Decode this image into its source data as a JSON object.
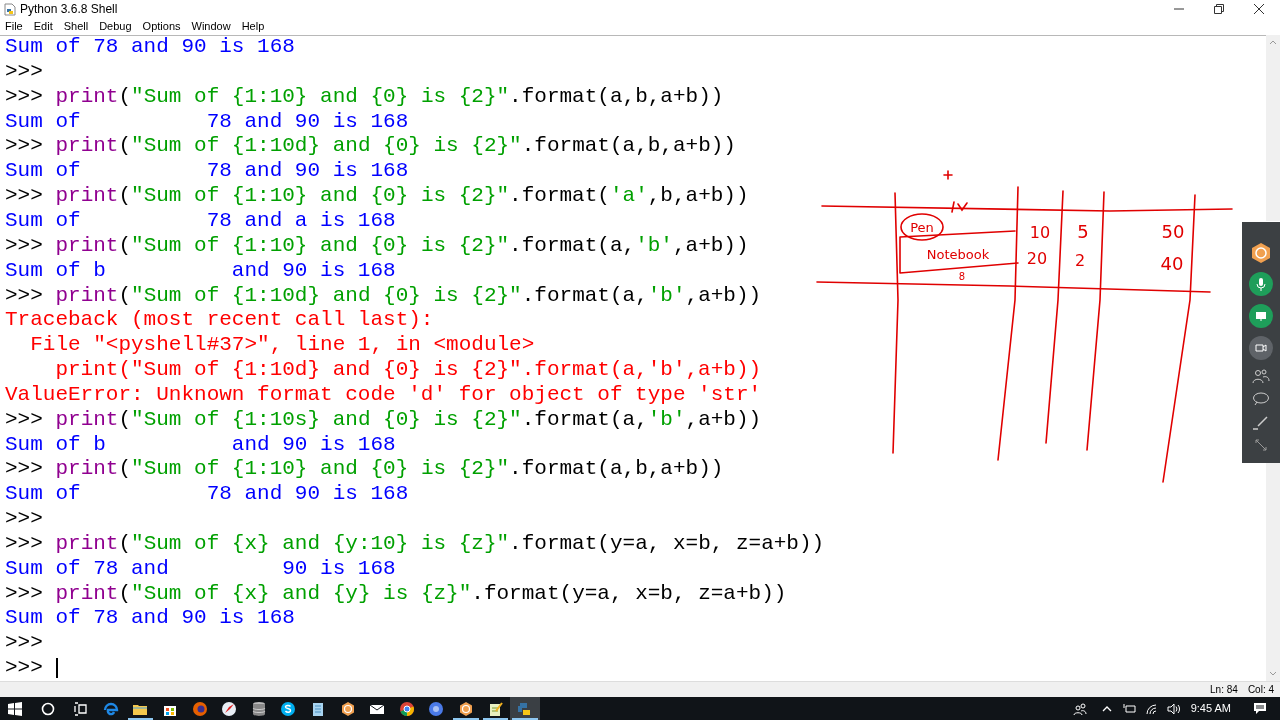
{
  "window": {
    "title": "Python 3.6.8 Shell"
  },
  "menu": [
    "File",
    "Edit",
    "Shell",
    "Debug",
    "Options",
    "Window",
    "Help"
  ],
  "shell_lines": [
    {
      "kind": "output",
      "text": "Sum of 78 and 90 is 168"
    },
    {
      "kind": "input",
      "prompt": ">>>"
    },
    {
      "kind": "input",
      "prompt": ">>>",
      "segments": [
        {
          "kind": "builtin",
          "text": "print"
        },
        {
          "kind": "plain",
          "text": "("
        },
        {
          "kind": "string",
          "text": "\"Sum of {1:10} and {0} is {2}\""
        },
        {
          "kind": "plain",
          "text": ".format(a,b,a+b))"
        }
      ]
    },
    {
      "kind": "output",
      "text": "Sum of          78 and 90 is 168"
    },
    {
      "kind": "input",
      "prompt": ">>>",
      "segments": [
        {
          "kind": "builtin",
          "text": "print"
        },
        {
          "kind": "plain",
          "text": "("
        },
        {
          "kind": "string",
          "text": "\"Sum of {1:10d} and {0} is {2}\""
        },
        {
          "kind": "plain",
          "text": ".format(a,b,a+b))"
        }
      ]
    },
    {
      "kind": "output",
      "text": "Sum of          78 and 90 is 168"
    },
    {
      "kind": "input",
      "prompt": ">>>",
      "segments": [
        {
          "kind": "builtin",
          "text": "print"
        },
        {
          "kind": "plain",
          "text": "("
        },
        {
          "kind": "string",
          "text": "\"Sum of {1:10} and {0} is {2}\""
        },
        {
          "kind": "plain",
          "text": ".format("
        },
        {
          "kind": "string",
          "text": "'a'"
        },
        {
          "kind": "plain",
          "text": ",b,a+b))"
        }
      ]
    },
    {
      "kind": "output",
      "text": "Sum of          78 and a is 168"
    },
    {
      "kind": "input",
      "prompt": ">>>",
      "segments": [
        {
          "kind": "builtin",
          "text": "print"
        },
        {
          "kind": "plain",
          "text": "("
        },
        {
          "kind": "string",
          "text": "\"Sum of {1:10} and {0} is {2}\""
        },
        {
          "kind": "plain",
          "text": ".format(a,"
        },
        {
          "kind": "string",
          "text": "'b'"
        },
        {
          "kind": "plain",
          "text": ",a+b))"
        }
      ]
    },
    {
      "kind": "output",
      "text": "Sum of b          and 90 is 168"
    },
    {
      "kind": "input",
      "prompt": ">>>",
      "segments": [
        {
          "kind": "builtin",
          "text": "print"
        },
        {
          "kind": "plain",
          "text": "("
        },
        {
          "kind": "string",
          "text": "\"Sum of {1:10d} and {0} is {2}\""
        },
        {
          "kind": "plain",
          "text": ".format(a,"
        },
        {
          "kind": "string",
          "text": "'b'"
        },
        {
          "kind": "plain",
          "text": ",a+b))"
        }
      ]
    },
    {
      "kind": "error",
      "text": "Traceback (most recent call last):"
    },
    {
      "kind": "error",
      "text": "  File \"<pyshell#37>\", line 1, in <module>"
    },
    {
      "kind": "error",
      "text": "    print(\"Sum of {1:10d} and {0} is {2}\".format(a,'b',a+b))"
    },
    {
      "kind": "error",
      "text": "ValueError: Unknown format code 'd' for object of type 'str'"
    },
    {
      "kind": "input",
      "prompt": ">>>",
      "segments": [
        {
          "kind": "builtin",
          "text": "print"
        },
        {
          "kind": "plain",
          "text": "("
        },
        {
          "kind": "string",
          "text": "\"Sum of {1:10s} and {0} is {2}\""
        },
        {
          "kind": "plain",
          "text": ".format(a,"
        },
        {
          "kind": "string",
          "text": "'b'"
        },
        {
          "kind": "plain",
          "text": ",a+b))"
        }
      ]
    },
    {
      "kind": "output",
      "text": "Sum of b          and 90 is 168"
    },
    {
      "kind": "input",
      "prompt": ">>>",
      "segments": [
        {
          "kind": "builtin",
          "text": "print"
        },
        {
          "kind": "plain",
          "text": "("
        },
        {
          "kind": "string",
          "text": "\"Sum of {1:10} and {0} is {2}\""
        },
        {
          "kind": "plain",
          "text": ".format(a,b,a+b))"
        }
      ]
    },
    {
      "kind": "output",
      "text": "Sum of          78 and 90 is 168"
    },
    {
      "kind": "input",
      "prompt": ">>>"
    },
    {
      "kind": "input",
      "prompt": ">>>",
      "segments": [
        {
          "kind": "builtin",
          "text": "print"
        },
        {
          "kind": "plain",
          "text": "("
        },
        {
          "kind": "string",
          "text": "\"Sum of {x} and {y:10} is {z}\""
        },
        {
          "kind": "plain",
          "text": ".format(y=a, x=b, z=a+b))"
        }
      ]
    },
    {
      "kind": "output",
      "text": "Sum of 78 and         90 is 168"
    },
    {
      "kind": "input",
      "prompt": ">>>",
      "segments": [
        {
          "kind": "builtin",
          "text": "print"
        },
        {
          "kind": "plain",
          "text": "("
        },
        {
          "kind": "string",
          "text": "\"Sum of {x} and {y} is {z}\""
        },
        {
          "kind": "plain",
          "text": ".format(y=a, x=b, z=a+b))"
        }
      ]
    },
    {
      "kind": "output",
      "text": "Sum of 78 and 90 is 168"
    },
    {
      "kind": "input",
      "prompt": ">>>"
    },
    {
      "kind": "input",
      "prompt": ">>>",
      "cursor": true
    }
  ],
  "annotation": {
    "labels": [
      "Pen",
      "Notebook",
      "8",
      "10",
      "20",
      "5",
      "2",
      "50",
      "40"
    ]
  },
  "status_bar": {
    "line": "Ln: 84",
    "column": "Col: 4"
  },
  "taskbar": {
    "items": [
      {
        "kind": "edge",
        "running": false,
        "selected": false
      },
      {
        "kind": "folder",
        "running": true,
        "selected": false
      },
      {
        "kind": "store",
        "running": false,
        "selected": false
      },
      {
        "kind": "firefox",
        "running": false,
        "selected": false
      },
      {
        "kind": "compass",
        "running": false,
        "selected": false
      },
      {
        "kind": "database",
        "running": false,
        "selected": false
      },
      {
        "kind": "skype",
        "running": false,
        "selected": false
      },
      {
        "kind": "notepad",
        "running": false,
        "selected": false
      },
      {
        "kind": "flower",
        "running": false,
        "selected": false
      },
      {
        "kind": "mail",
        "running": false,
        "selected": false
      },
      {
        "kind": "chrome",
        "running": false,
        "selected": false
      },
      {
        "kind": "globe",
        "running": false,
        "selected": false
      },
      {
        "kind": "flower",
        "running": true,
        "selected": false
      },
      {
        "kind": "notepad-pencil",
        "running": true,
        "selected": false
      },
      {
        "kind": "python",
        "running": true,
        "selected": true
      }
    ],
    "clock": "9:45 AM"
  }
}
